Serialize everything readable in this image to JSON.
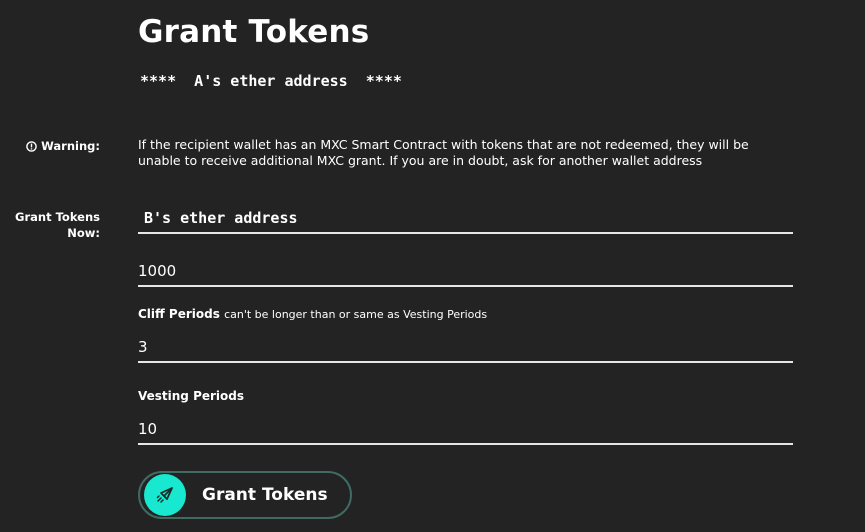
{
  "page": {
    "title": "Grant Tokens",
    "sender_line": "****  A's ether address  ****"
  },
  "warning": {
    "icon": "info-circle-icon",
    "label": "Warning:",
    "text": "If the recipient wallet has an MXC Smart Contract with tokens that are not redeemed, they will be unable to receive additional MXC grant. If you are in doubt, ask for another wallet address"
  },
  "grant": {
    "label": "Grant Tokens Now:",
    "recipient_value": "B's ether address",
    "amount_value": "1000"
  },
  "cliff": {
    "label": "Cliff Periods",
    "note": "can't be longer than or same as Vesting Periods",
    "value": "3"
  },
  "vesting": {
    "label": "Vesting Periods",
    "value": "10"
  },
  "submit": {
    "label": "Grant Tokens",
    "icon": "rocket-icon",
    "accent_color": "#17e8cf"
  }
}
